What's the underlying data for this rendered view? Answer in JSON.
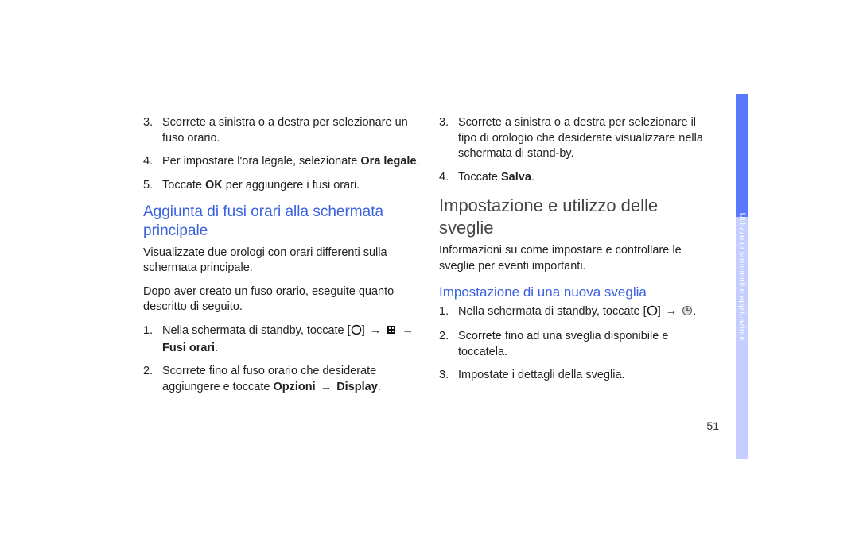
{
  "left": {
    "li3": "Scorrete a sinistra o a destra per selezionare un fuso orario.",
    "li4a": "Per impostare l'ora legale, selezionate ",
    "li4b": "Ora legale",
    "li4c": ".",
    "li5a": "Toccate ",
    "li5b": "OK",
    "li5c": " per aggiungere i fusi orari.",
    "h2": "Aggiunta di fusi orari alla schermata principale",
    "p1": "Visualizzate due orologi con orari differenti sulla schermata principale.",
    "p2": "Dopo aver creato un fuso orario, eseguite quanto descritto di seguito.",
    "s1a": "Nella schermata di standby, toccate [",
    "s1arrow1": "→",
    "s1arrow2": "→",
    "s1b": "Fusi orari",
    "s1c": ".",
    "s2a": "Scorrete fino al fuso orario che desiderate aggiungere e toccate ",
    "s2b": "Opzioni",
    "s2arrow": "→",
    "s2c": "Display",
    "s2d": "."
  },
  "right": {
    "li3": "Scorrete a sinistra o a destra per selezionare il tipo di orologio che desiderate visualizzare nella schermata di stand-by.",
    "li4a": "Toccate ",
    "li4b": "Salva",
    "li4c": ".",
    "h1": "Impostazione e utilizzo delle sveglie",
    "p1": "Informazioni su come impostare e controllare le sveglie per eventi importanti.",
    "h3": "Impostazione di una nuova sveglia",
    "s1a": "Nella schermata di standby, toccate [",
    "s1arrow": "→",
    "s1b": ".",
    "s2": "Scorrete fino ad una sveglia disponibile e toccatela.",
    "s3": "Impostate i dettagli della sveglia."
  },
  "sidebar": "Utilizzo di strumenti e applicazioni",
  "pagenum": "51",
  "nums": {
    "n1": "1.",
    "n2": "2.",
    "n3": "3.",
    "n4": "4.",
    "n5": "5."
  }
}
